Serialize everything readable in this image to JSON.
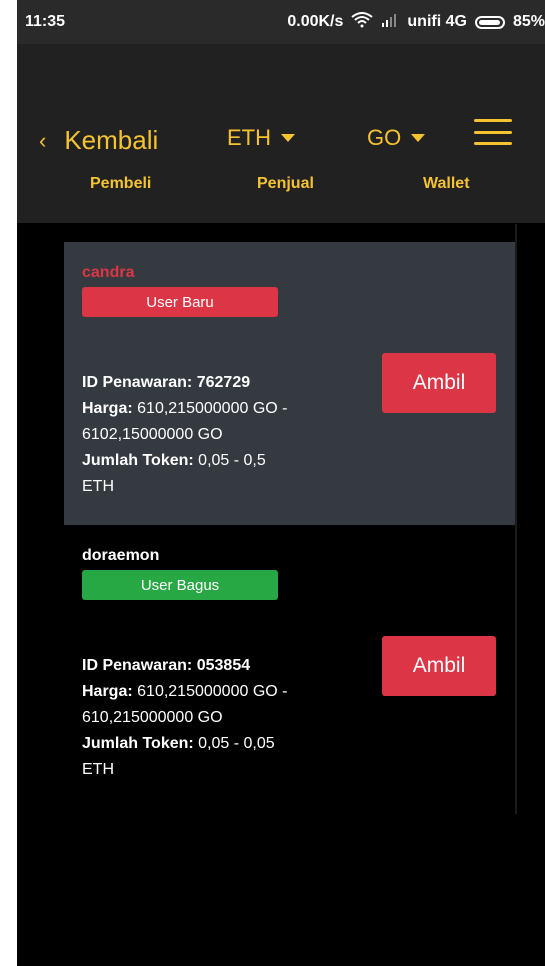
{
  "status": {
    "time": "11:35",
    "net": "0.00K/s",
    "carrier": "unifi 4G",
    "battery": "85%"
  },
  "nav": {
    "back_label": "Kembali",
    "coin": "ETH",
    "pair": "GO"
  },
  "tabs": [
    "Pembeli",
    "Penjual",
    "Wallet"
  ],
  "labels": {
    "id": "ID Penawaran:",
    "price": "Harga:",
    "amount": "Jumlah Token:",
    "action": "Ambil"
  },
  "offers": [
    {
      "user": "candra",
      "user_color": "#dc3545",
      "badge": "User Baru",
      "badge_color": "#dc3545",
      "id": "762729",
      "price_line1": "610,215000000 GO -",
      "price_line2": "6102,15000000 GO",
      "amount_line1": "0,05 - 0,5",
      "amount_line2": "ETH"
    },
    {
      "user": "doraemon",
      "user_color": "#ffffff",
      "badge": "User Bagus",
      "badge_color": "#28a745",
      "id": "053854",
      "price_line1": "610,215000000 GO -",
      "price_line2": "610,215000000 GO",
      "amount_line1": "0,05 - 0,05",
      "amount_line2": "ETH"
    }
  ],
  "colors": {
    "accent": "#f5c230",
    "danger": "#dc3545",
    "success": "#28a745"
  }
}
